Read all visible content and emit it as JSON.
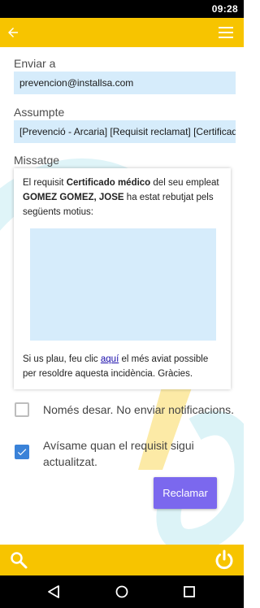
{
  "status_bar": {
    "time": "09:28"
  },
  "app_bar": {
    "back_icon": "arrow-back-icon",
    "menu_icon": "hamburger-menu-icon"
  },
  "form": {
    "to_label": "Enviar a",
    "to_value": "prevencion@installsa.com",
    "subject_label": "Assumpte",
    "subject_value": "[Prevenció - Arcaria]  [Requisit reclamat] [Certificado médico]",
    "message_label": "Missatge"
  },
  "message": {
    "line1_prefix": "El requisit ",
    "requirement": "Certificado médico",
    "line1_middle": " del seu empleat ",
    "employee": "GOMEZ GOMEZ, JOSE",
    "line1_suffix": " ha estat rebutjat pels següents motius:",
    "footer_prefix": "Si us plau, feu clic ",
    "footer_link": "aquí",
    "footer_suffix": " el més aviat possible per resoldre aquesta incidència. Gràcies."
  },
  "options": {
    "save_only_label": "Només desar. No enviar notificacions.",
    "save_only_checked": false,
    "notify_label": "Avísame quan el requisit sigui actualitzat.",
    "notify_checked": true
  },
  "actions": {
    "submit_label": "Reclamar"
  },
  "bottom_bar": {
    "search_icon": "search-icon",
    "power_icon": "power-icon"
  },
  "nav_bar": {
    "back_icon": "nav-back-icon",
    "home_icon": "nav-home-icon",
    "recents_icon": "nav-recents-icon"
  },
  "colors": {
    "accent": "#f7c400",
    "button": "#7b68ee",
    "field": "#d6ecfb",
    "checkbox": "#3a82d8"
  }
}
